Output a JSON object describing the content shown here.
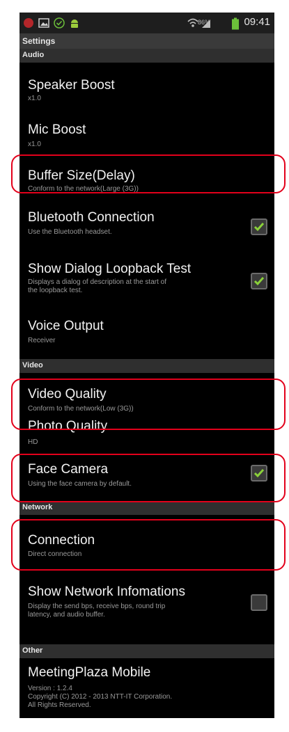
{
  "status_bar": {
    "battery_percent": "86%",
    "time": "09:41",
    "icons": [
      "app-notification-icon",
      "image-icon",
      "check-circle-icon",
      "android-icon",
      "wifi-icon",
      "signal-icon",
      "battery-icon"
    ]
  },
  "screen": {
    "title": "Settings"
  },
  "sections": {
    "audio": "Audio",
    "video": "Video",
    "network": "Network",
    "other": "Other"
  },
  "items": {
    "speaker_boost": {
      "title": "Speaker Boost",
      "summary": "x1.0"
    },
    "mic_boost": {
      "title": "Mic Boost",
      "summary": "x1.0"
    },
    "buffer_size": {
      "title": "Buffer Size(Delay)",
      "summary": "Conform to the network(Large (3G))"
    },
    "bluetooth": {
      "title": "Bluetooth Connection",
      "summary": "Use the Bluetooth headset.",
      "checked": true
    },
    "loopback": {
      "title": "Show Dialog Loopback Test",
      "summary_line1": "Displays a dialog of description at the start of",
      "summary_line2": "the loopback test.",
      "checked": true
    },
    "voice_output": {
      "title": "Voice Output",
      "summary": "Receiver"
    },
    "video_quality": {
      "title": "Video Quality",
      "summary": "Conform to the network(Low (3G))"
    },
    "photo_quality": {
      "title": "Photo Quality",
      "summary": "HD"
    },
    "face_camera": {
      "title": "Face Camera",
      "summary": "Using the face camera by default.",
      "checked": true
    },
    "connection": {
      "title": "Connection",
      "summary": "Direct connection"
    },
    "network_info": {
      "title": "Show Network Infomations",
      "summary_line1": "Display the send bps, receive bps, round trip",
      "summary_line2": "latency, and audio buffer.",
      "checked": false
    },
    "about": {
      "title": "MeetingPlaza Mobile",
      "line1": "Version : 1.2.4",
      "line2": "Copyright (C) 2012 - 2013 NTT-IT Corporation.",
      "line3": "All Rights Reserved."
    }
  },
  "colors": {
    "highlight": "#e3001b",
    "check": "#8bd13a"
  }
}
